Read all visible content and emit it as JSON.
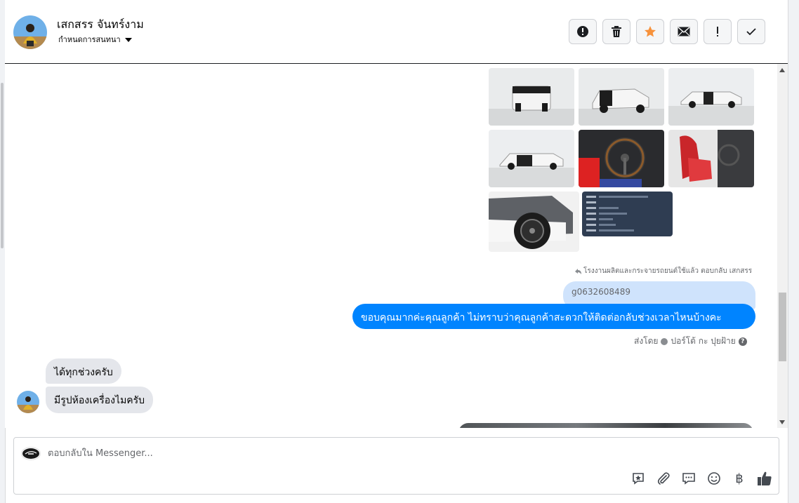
{
  "header": {
    "contact_name": "เสกสรร จันทร์งาม",
    "assign_label": "กำหนดการสนทนา",
    "actions": [
      {
        "name": "report-spam",
        "icon": "exclamation-circle-icon"
      },
      {
        "name": "delete",
        "icon": "trash-icon"
      },
      {
        "name": "star",
        "icon": "star-icon",
        "color": "#f7923b"
      },
      {
        "name": "mark-unread",
        "icon": "envelope-icon"
      },
      {
        "name": "mark-important",
        "icon": "exclamation-icon"
      },
      {
        "name": "mark-done",
        "icon": "checkmark-icon"
      }
    ]
  },
  "chat": {
    "reply_meta": "โรงงานผลิตและกระจายรถยนต์ใช้แล้ว ตอบกลับ เสกสรร",
    "quoted_phone": "g0632608489",
    "page_message": "ขอบคุณมากค่ะคุณลูกค้า ไม่ทราบว่าคุณลูกค้าสะดวกให้ติดต่อกลับช่วงเวลาไหนบ้างคะ",
    "sent_by_label": "ส่งโดย",
    "sent_by_name": "ปอร์โต้ กะ ปุยฝ้าย",
    "customer_messages": [
      "ได้ทุกช่วงครับ",
      "มีรูปห้องเครื่องไมครับ"
    ],
    "image_grid": [
      "truck-rear",
      "truck-rear-quarter",
      "truck-side-interior-room",
      "truck-side",
      "steering-wheel-interior",
      "red-seats-interior",
      "wheel-closeup",
      "document-screenshot"
    ]
  },
  "composer": {
    "placeholder": "ตอบกลับใน Messenger...",
    "tools": [
      "saved-reply-icon",
      "paperclip-icon",
      "chat-bubble-icon",
      "emoji-icon",
      "baht-icon",
      "thumbs-up-icon"
    ]
  },
  "colors": {
    "accent_blue": "#0084ff",
    "quote_bubble": "#cfe3fc",
    "incoming_bubble": "#e4e6eb",
    "star": "#f7923b"
  }
}
